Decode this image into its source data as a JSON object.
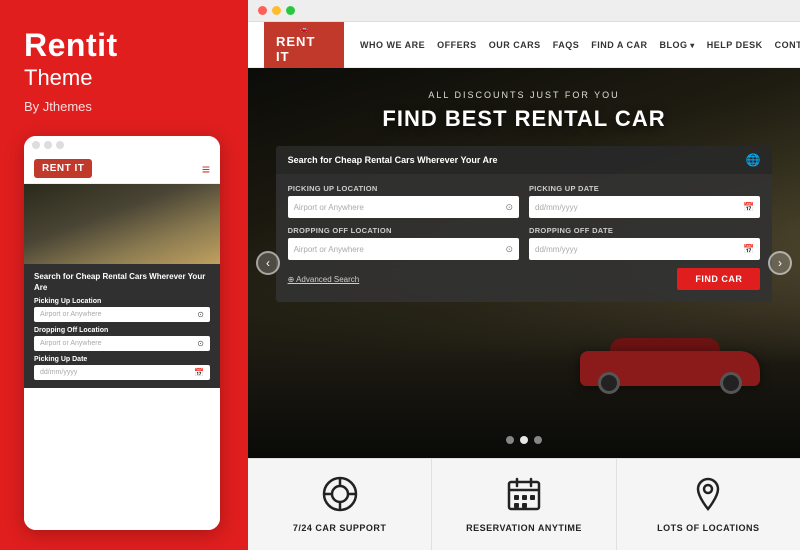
{
  "left": {
    "title": "Rentit",
    "subtitle": "Theme",
    "by": "By Jthemes",
    "mobile_dots": [
      "dot1",
      "dot2",
      "dot3"
    ],
    "mobile_logo": "RENT IT",
    "mobile_hamburger": "≡",
    "mobile_search_title": "Search for Cheap Rental Cars Wherever Your Are",
    "fields": {
      "pickup_location": "Picking Up Location",
      "pickup_placeholder": "Airport or Anywhere",
      "dropoff_location": "Dropping Off Location",
      "dropoff_placeholder": "Airport or Anywhere",
      "pickup_date": "Picking Up Date",
      "pickup_date_placeholder": "dd/mm/yyyy",
      "dropoff_date": "Dropping Off Date"
    }
  },
  "right": {
    "browser_dots": [
      "red",
      "yellow",
      "green"
    ],
    "nav": {
      "logo": "RENT IT",
      "items": [
        "WHO WE ARE",
        "OFFERS",
        "OUR CARS",
        "FAQS",
        "FIND A CAR",
        "BLOG",
        "HELP DESK",
        "CONTACT"
      ]
    },
    "hero": {
      "subtitle": "ALL DISCOUNTS JUST FOR YOU",
      "title": "FIND BEST RENTAL CAR",
      "search_header": "Search for Cheap Rental Cars Wherever Your Are",
      "fields": {
        "pickup_location_label": "Picking Up Location",
        "pickup_location_placeholder": "Airport or Anywhere",
        "pickup_date_label": "Picking Up Date",
        "pickup_date_placeholder": "dd/mm/yyyy",
        "dropoff_location_label": "Dropping Off Location",
        "dropoff_location_placeholder": "Airport or Anywhere",
        "dropoff_date_label": "Dropping Off Date",
        "dropoff_date_placeholder": "dd/mm/yyyy"
      },
      "advanced_search": "Advanced Search",
      "find_car_btn": "FIND CAR",
      "dots": [
        1,
        2,
        3
      ]
    },
    "features": [
      {
        "icon": "🔘",
        "label": "7/24 CAR SUPPORT"
      },
      {
        "icon": "📅",
        "label": "RESERVATION ANYTIME"
      },
      {
        "icon": "📍",
        "label": "LOTS OF LOCATIONS"
      }
    ]
  }
}
